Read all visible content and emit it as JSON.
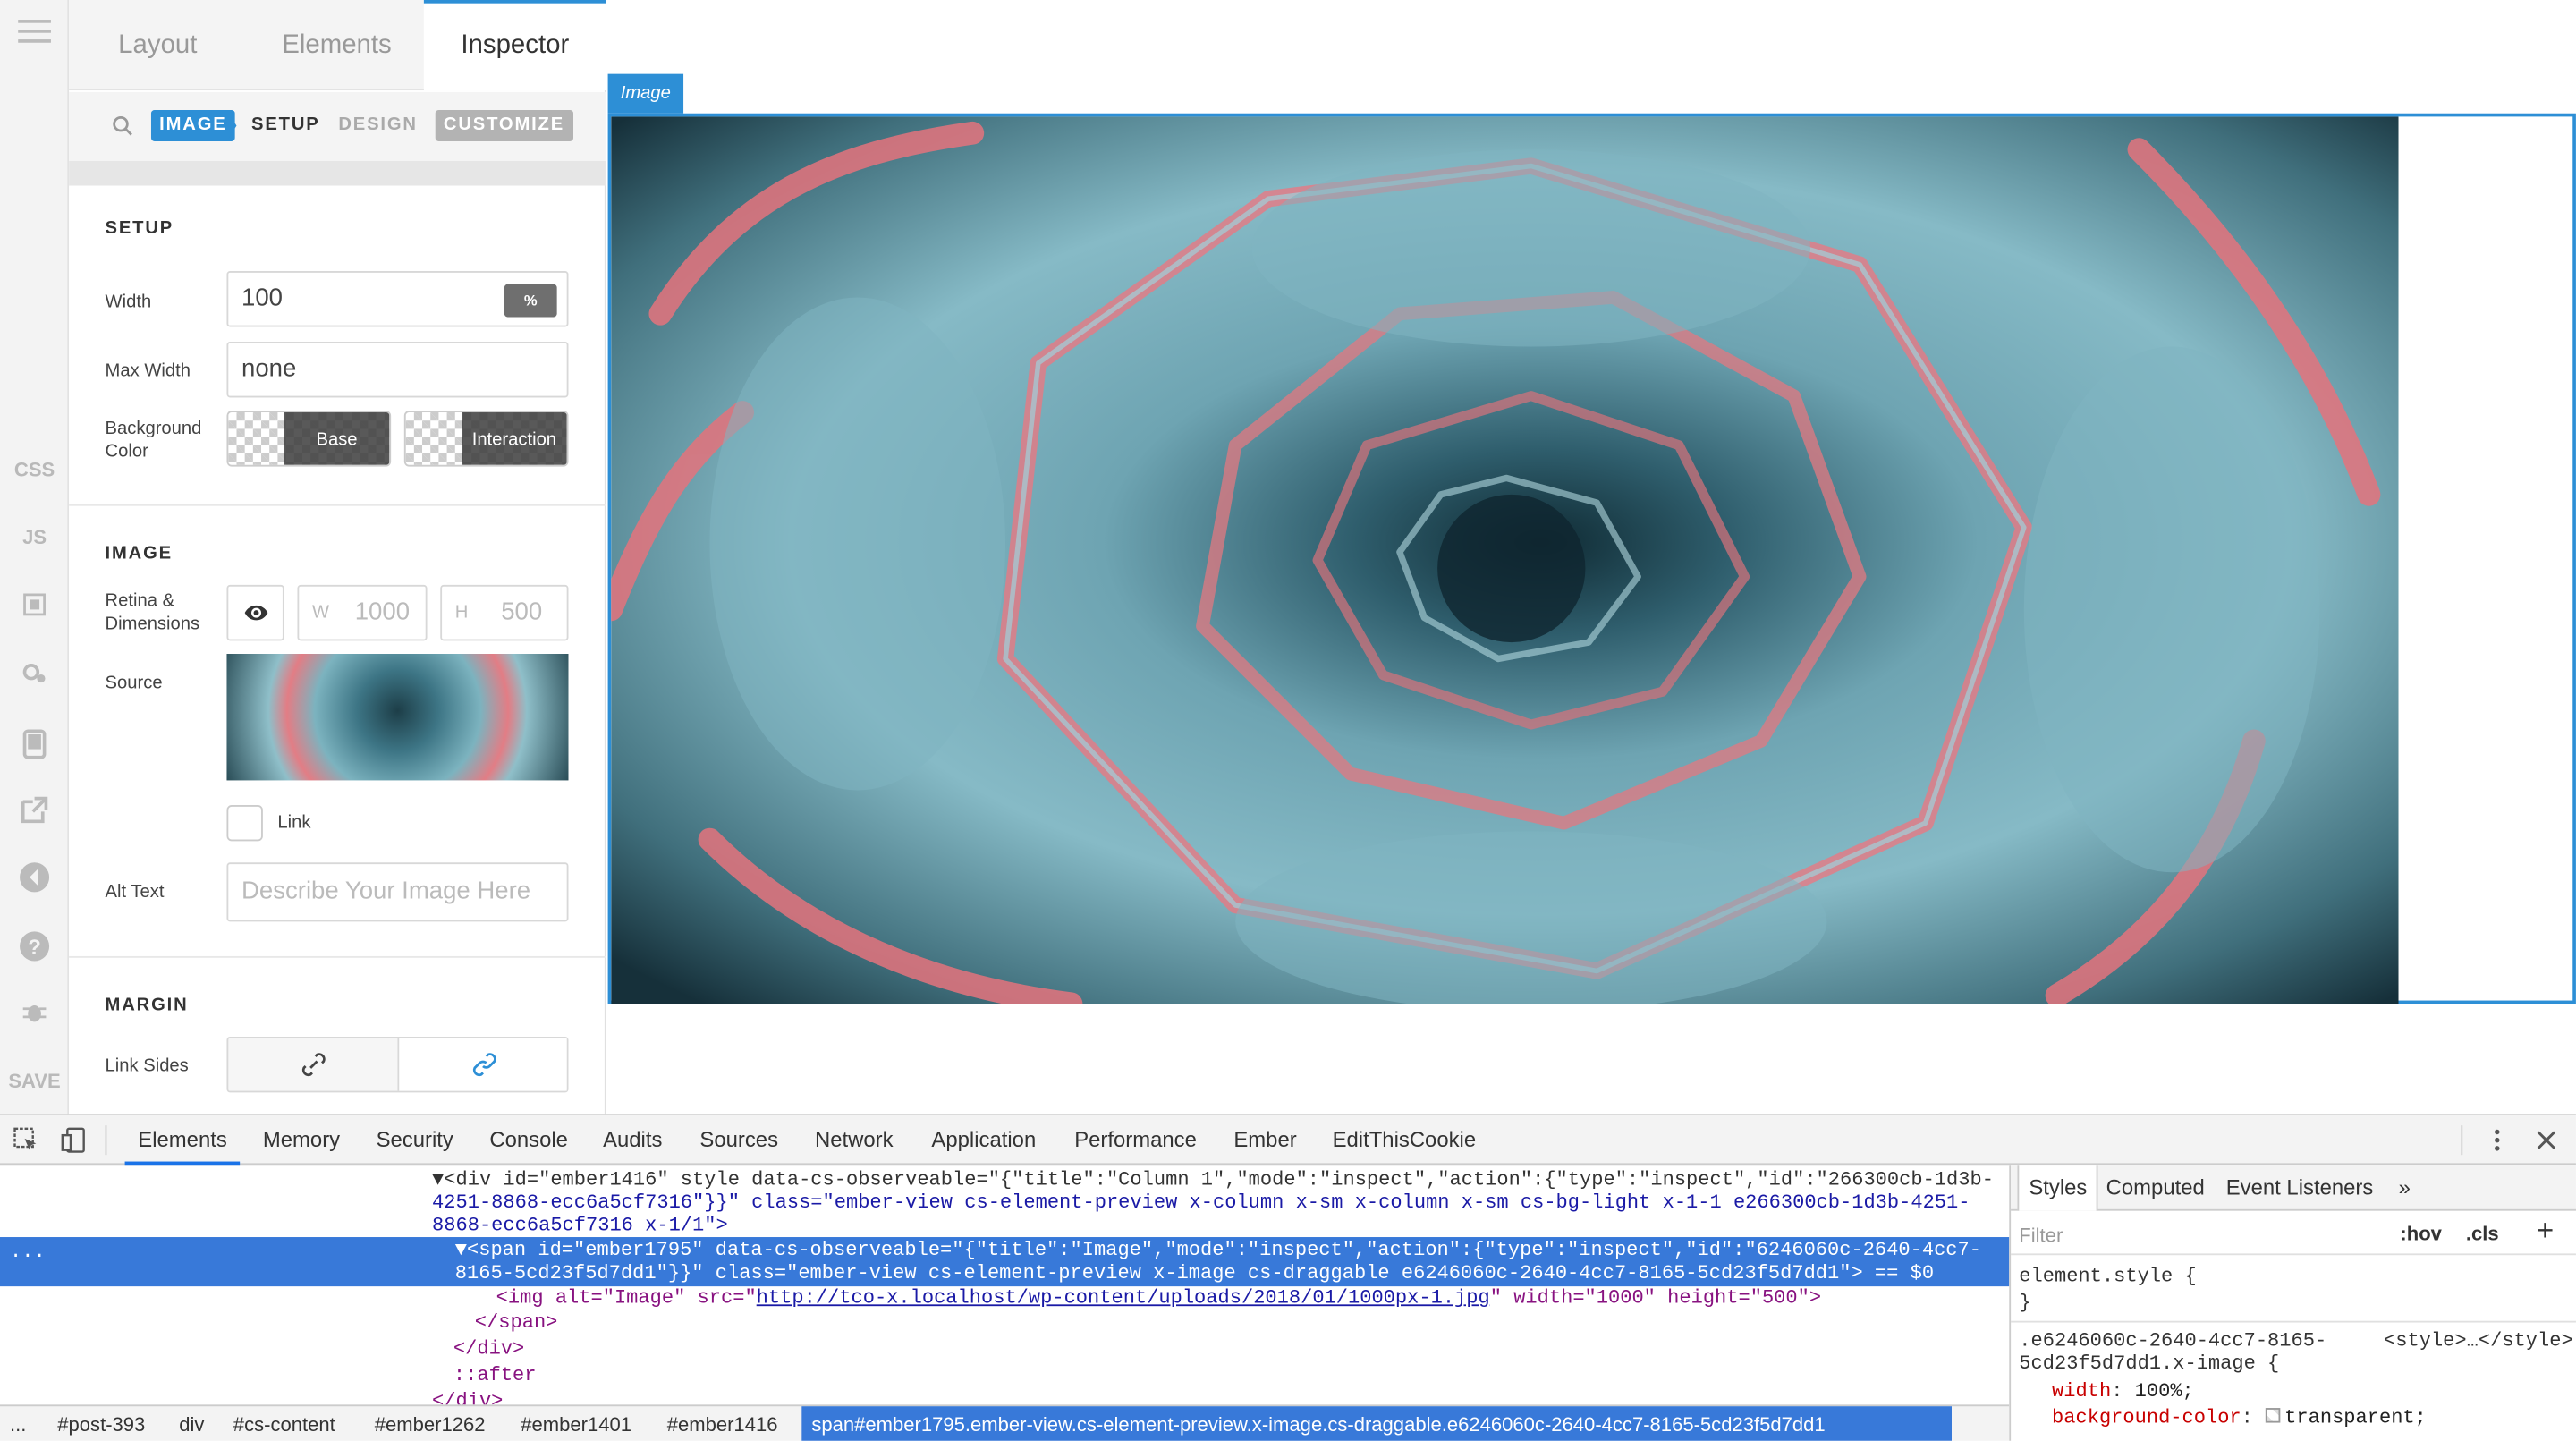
{
  "rail": {
    "items": [
      "CSS",
      "JS",
      "SAVE"
    ]
  },
  "panel": {
    "tabs": [
      "Layout",
      "Elements",
      "Inspector"
    ],
    "subnav": {
      "element_badge": "IMAGE",
      "items": [
        "SETUP",
        "DESIGN",
        "CUSTOMIZE"
      ]
    },
    "setup": {
      "title": "SETUP",
      "width_label": "Width",
      "width_value": "100",
      "width_unit": "%",
      "max_width_label": "Max Width",
      "max_width_value": "none",
      "bg_label_1": "Background",
      "bg_label_2": "Color",
      "bg_base": "Base",
      "bg_interaction": "Interaction"
    },
    "image": {
      "title": "IMAGE",
      "retina_label_1": "Retina &",
      "retina_label_2": "Dimensions",
      "w_prefix": "W",
      "w_value": "1000",
      "h_prefix": "H",
      "h_value": "500",
      "source_label": "Source",
      "link_label": "Link",
      "alt_label": "Alt Text",
      "alt_placeholder": "Describe Your Image Here"
    },
    "margin": {
      "title": "MARGIN",
      "link_sides_label": "Link Sides"
    }
  },
  "canvas": {
    "tag_label": "Image"
  },
  "devtools": {
    "tabs": [
      "Elements",
      "Memory",
      "Security",
      "Console",
      "Audits",
      "Sources",
      "Network",
      "Application",
      "Performance",
      "Ember",
      "EditThisCookie"
    ],
    "lines": {
      "l1a": "▼<div id=\"ember1416\" style data-cs-observeable=\"{\"title\":\"Column 1\",\"mode\":\"inspect\",\"action\":{\"type\":\"inspect\",\"id\":\"266300cb-1d3b-",
      "l1b": "4251-8868-ecc6a5cf7316\"}}\" class=\"ember-view cs-element-preview x-column x-sm x-column x-sm cs-bg-light x-1-1 e266300cb-1d3b-4251-",
      "l1c": "8868-ecc6a5cf7316 x-1/1\">",
      "l2a": "▼<span id=\"ember1795\" data-cs-observeable=\"{\"title\":\"Image\",\"mode\":\"inspect\",\"action\":{\"type\":\"inspect\",\"id\":\"6246060c-2640-4cc7-",
      "l2b": "8165-5cd23f5d7dd1\"}}\" class=\"ember-view cs-element-preview x-image cs-draggable e6246060c-2640-4cc7-8165-5cd23f5d7dd1\"> == $0",
      "l3_open": "<img alt=\"Image\" src=\"",
      "l3_link": "http://tco-x.localhost/wp-content/uploads/2018/01/1000px-1.jpg",
      "l3_close": "\" width=\"1000\" height=\"500\">",
      "l4": "</span>",
      "l5": "</div>",
      "l6": "::after",
      "l7": "</div>"
    },
    "crumbs": [
      "...",
      "#post-393",
      "div",
      "#cs-content",
      "#ember1262",
      "#ember1401",
      "#ember1416"
    ],
    "crumb_active": "span#ember1795.ember-view.cs-element-preview.x-image.cs-draggable.e6246060c-2640-4cc7-8165-5cd23f5d7dd1",
    "styles": {
      "tabs": [
        "Styles",
        "Computed",
        "Event Listeners",
        "»"
      ],
      "filter_placeholder": "Filter",
      "hov": ":hov",
      "cls": ".cls",
      "plus": "+",
      "element_style": "element.style {",
      "close_brace": "}",
      "rule_selector_1": ".e6246060c-2640-4cc7-8165-",
      "rule_selector_2": "5cd23f5d7dd1.x-image {",
      "rule_source": "<style>…</style>",
      "prop1_name": "width",
      "prop1_value": "100%;",
      "prop2_name": "background-color",
      "prop2_value": "transparent;"
    }
  }
}
